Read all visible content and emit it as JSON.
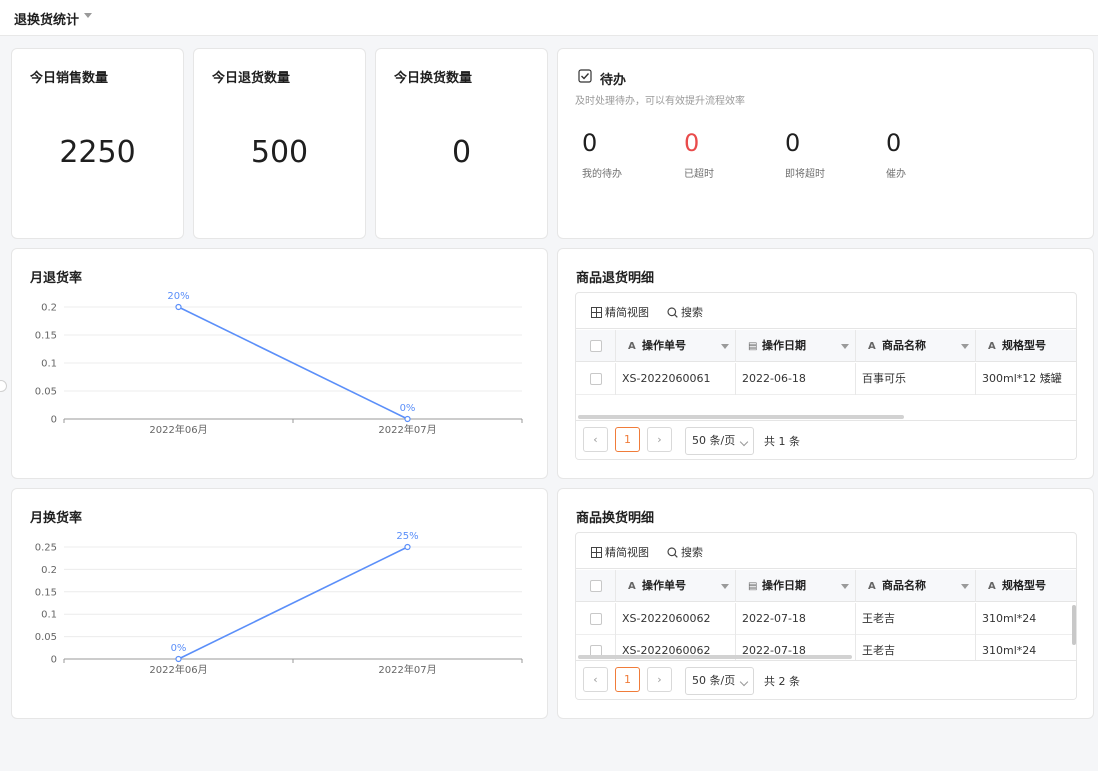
{
  "header": {
    "title": "退换货统计"
  },
  "stats": [
    {
      "label": "今日销售数量",
      "value": "2250"
    },
    {
      "label": "今日退货数量",
      "value": "500"
    },
    {
      "label": "今日换货数量",
      "value": "0"
    }
  ],
  "todo": {
    "title": "待办",
    "subtitle": "及时处理待办，可以有效提升流程效率",
    "items": [
      {
        "value": "0",
        "label": "我的待办"
      },
      {
        "value": "0",
        "label": "已超时"
      },
      {
        "value": "0",
        "label": "即将超时"
      },
      {
        "value": "0",
        "label": "催办"
      }
    ],
    "alert_color": "#e94b4b"
  },
  "charts": {
    "return_title": "月退货率",
    "exchange_title": "月换货率"
  },
  "chart_data": [
    {
      "type": "line",
      "title": "月退货率",
      "categories": [
        "2022年06月",
        "2022年07月"
      ],
      "values": [
        0.2,
        0
      ],
      "data_labels": [
        "20%",
        "0%"
      ],
      "yticks": [
        "0",
        "0.05",
        "0.1",
        "0.15",
        "0.2"
      ],
      "ylim": [
        0,
        0.2
      ],
      "grid": true,
      "color": "#5b8ff9"
    },
    {
      "type": "line",
      "title": "月换货率",
      "categories": [
        "2022年06月",
        "2022年07月"
      ],
      "values": [
        0,
        0.25
      ],
      "data_labels": [
        "0%",
        "25%"
      ],
      "yticks": [
        "0",
        "0.05",
        "0.1",
        "0.15",
        "0.2",
        "0.25"
      ],
      "ylim": [
        0,
        0.25
      ],
      "grid": true,
      "color": "#5b8ff9"
    }
  ],
  "return_detail": {
    "title": "商品退货明细",
    "toolbar": {
      "view": "精简视图",
      "search": "搜索"
    },
    "columns": [
      "操作单号",
      "操作日期",
      "商品名称",
      "规格型号"
    ],
    "rows": [
      [
        "XS-2022060061",
        "2022-06-18",
        "百事可乐",
        "300ml*12 矮罐"
      ]
    ],
    "pager": {
      "page": "1",
      "size": "50 条/页",
      "total": "共 1 条"
    }
  },
  "exchange_detail": {
    "title": "商品换货明细",
    "toolbar": {
      "view": "精简视图",
      "search": "搜索"
    },
    "columns": [
      "操作单号",
      "操作日期",
      "商品名称",
      "规格型号"
    ],
    "rows": [
      [
        "XS-2022060062",
        "2022-07-18",
        "王老吉",
        "310ml*24"
      ],
      [
        "XS-2022060062",
        "2022-07-18",
        "王老吉",
        "310ml*24"
      ]
    ],
    "pager": {
      "page": "1",
      "size": "50 条/页",
      "total": "共 2 条"
    }
  },
  "icons": {
    "prev": "‹",
    "next": "›",
    "text_col": "A",
    "date_col": "▤"
  }
}
